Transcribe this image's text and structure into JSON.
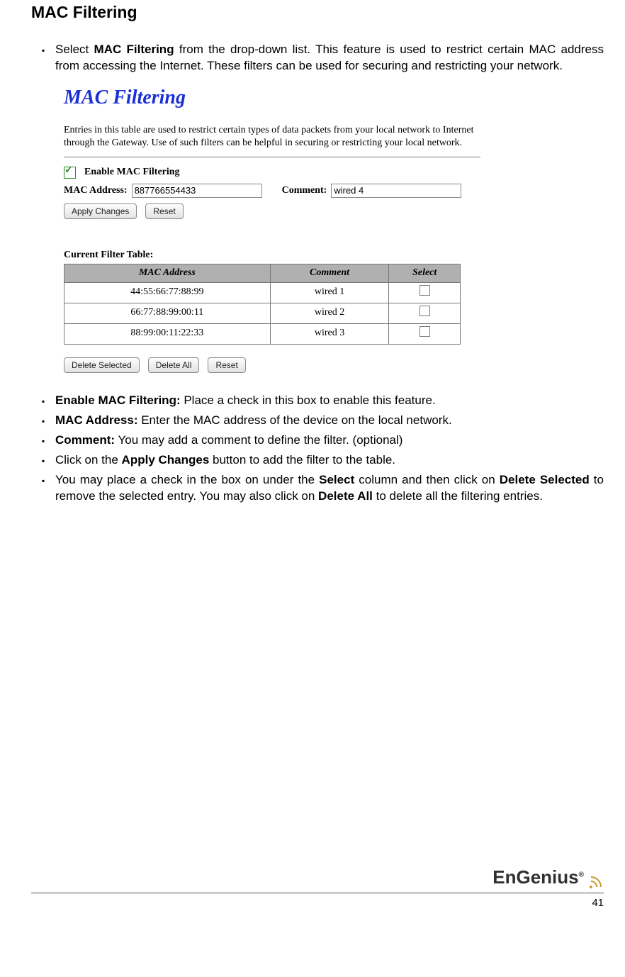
{
  "section_title": "MAC Filtering",
  "intro": {
    "s1": "Select ",
    "b1": "MAC Filtering",
    "s2": " from the drop-down list. This feature is used to restrict certain MAC address from accessing the Internet. These filters can be used for securing and restricting your network."
  },
  "panel": {
    "title": "MAC Filtering",
    "lead": "Entries in this table are used to restrict certain types of data packets from your local network to Internet through the Gateway. Use of such filters can be helpful in securing or restricting your local network.",
    "enable_label": "Enable MAC Filtering",
    "mac_label": "MAC Address:",
    "mac_value": "887766554433",
    "comment_label": "Comment:",
    "comment_value": "wired 4",
    "apply_btn": "Apply Changes",
    "reset_btn": "Reset",
    "table_caption": "Current Filter Table:",
    "cols": {
      "mac": "MAC Address",
      "comment": "Comment",
      "select": "Select"
    },
    "rows": [
      {
        "mac": "44:55:66:77:88:99",
        "comment": "wired 1"
      },
      {
        "mac": "66:77:88:99:00:11",
        "comment": "wired 2"
      },
      {
        "mac": "88:99:00:11:22:33",
        "comment": "wired 3"
      }
    ],
    "del_sel_btn": "Delete Selected",
    "del_all_btn": "Delete All",
    "reset2_btn": "Reset"
  },
  "defs": {
    "i1": {
      "b": "Enable MAC Filtering:",
      "t": " Place a check in this box to enable this feature."
    },
    "i2": {
      "b": "MAC Address:",
      "t": " Enter the MAC address of the device on the local network."
    },
    "i3": {
      "b": "Comment:",
      "t": " You may add a comment to define the filter. (optional)"
    },
    "i4": {
      "s1": "Click on the ",
      "b": "Apply Changes",
      "s2": " button to add the filter to the table."
    },
    "i5": {
      "s1": "You may place a check in the box on under the ",
      "b1": "Select",
      "s2": " column and then click on ",
      "b2": "Delete Selected",
      "s3": " to remove the selected entry. You may also click on ",
      "b3": "Delete All",
      "s4": " to delete all the filtering entries."
    }
  },
  "footer": {
    "brand": "EnGenius",
    "page": "41"
  }
}
